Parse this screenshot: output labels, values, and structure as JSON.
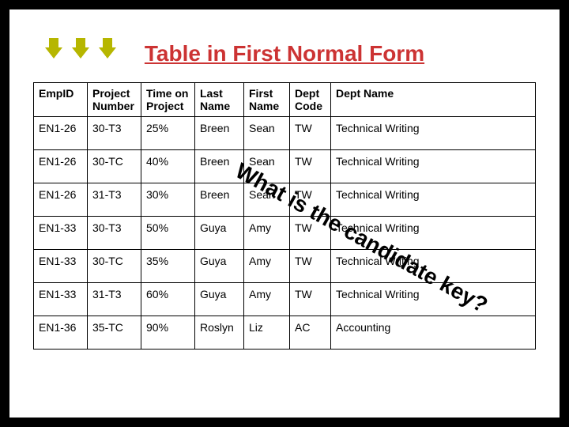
{
  "title": "Table in First Normal Form",
  "columns": {
    "empid": "EmpID",
    "projnum": "Project Number",
    "time": "Time on Project",
    "last": "Last Name",
    "first": "First Name",
    "dcode": "Dept Code",
    "dname": "Dept Name"
  },
  "rows": [
    {
      "empid": "EN1-26",
      "projnum": "30-T3",
      "time": "25%",
      "last": "Breen",
      "first": "Sean",
      "dcode": "TW",
      "dname": "Technical Writing"
    },
    {
      "empid": "EN1-26",
      "projnum": "30-TC",
      "time": "40%",
      "last": "Breen",
      "first": "Sean",
      "dcode": "TW",
      "dname": "Technical Writing"
    },
    {
      "empid": "EN1-26",
      "projnum": "31-T3",
      "time": "30%",
      "last": "Breen",
      "first": "Sean",
      "dcode": "TW",
      "dname": "Technical Writing"
    },
    {
      "empid": "EN1-33",
      "projnum": "30-T3",
      "time": "50%",
      "last": "Guya",
      "first": "Amy",
      "dcode": "TW",
      "dname": "Technical Writing"
    },
    {
      "empid": "EN1-33",
      "projnum": "30-TC",
      "time": "35%",
      "last": "Guya",
      "first": "Amy",
      "dcode": "TW",
      "dname": "Technical Writing"
    },
    {
      "empid": "EN1-33",
      "projnum": "31-T3",
      "time": "60%",
      "last": "Guya",
      "first": "Amy",
      "dcode": "TW",
      "dname": "Technical Writing"
    },
    {
      "empid": "EN1-36",
      "projnum": "35-TC",
      "time": "90%",
      "last": "Roslyn",
      "first": "Liz",
      "dcode": "AC",
      "dname": "Accounting"
    }
  ],
  "overlay": "What is the candidate key?",
  "chart_data": {
    "type": "table",
    "title": "Table in First Normal Form",
    "columns": [
      "EmpID",
      "Project Number",
      "Time on Project",
      "Last Name",
      "First Name",
      "Dept Code",
      "Dept Name"
    ],
    "rows": [
      [
        "EN1-26",
        "30-T3",
        "25%",
        "Breen",
        "Sean",
        "TW",
        "Technical Writing"
      ],
      [
        "EN1-26",
        "30-TC",
        "40%",
        "Breen",
        "Sean",
        "TW",
        "Technical Writing"
      ],
      [
        "EN1-26",
        "31-T3",
        "30%",
        "Breen",
        "Sean",
        "TW",
        "Technical Writing"
      ],
      [
        "EN1-33",
        "30-T3",
        "50%",
        "Guya",
        "Amy",
        "TW",
        "Technical Writing"
      ],
      [
        "EN1-33",
        "30-TC",
        "35%",
        "Guya",
        "Amy",
        "TW",
        "Technical Writing"
      ],
      [
        "EN1-33",
        "31-T3",
        "60%",
        "Guya",
        "Amy",
        "TW",
        "Technical Writing"
      ],
      [
        "EN1-36",
        "35-TC",
        "90%",
        "Roslyn",
        "Liz",
        "AC",
        "Accounting"
      ]
    ],
    "annotations": [
      "What is the candidate key?"
    ]
  }
}
